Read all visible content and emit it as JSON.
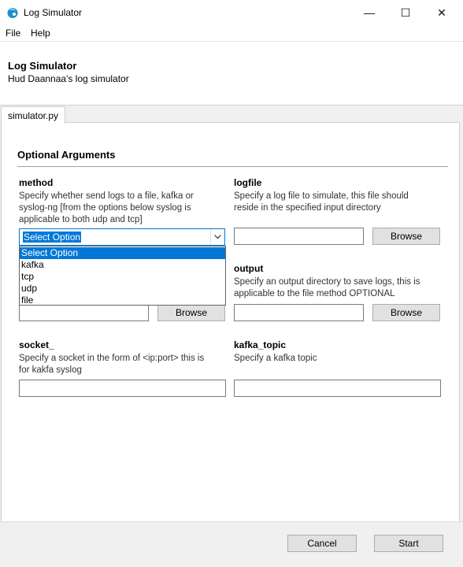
{
  "window": {
    "title": "Log Simulator",
    "minimize_glyph": "—",
    "maximize_glyph": "☐",
    "close_glyph": "✕"
  },
  "menu": {
    "items": [
      "File",
      "Help"
    ]
  },
  "header": {
    "title": "Log Simulator",
    "subtitle": "Hud Daannaa's log simulator"
  },
  "tab": {
    "label": "simulator.py"
  },
  "section": {
    "title": "Optional Arguments"
  },
  "fields": {
    "method": {
      "label": "method",
      "desc_lines": [
        "Specify whether send logs to a file, kafka or",
        "syslog-ng [from the options below syslog is",
        "applicable to both udp and tcp]"
      ],
      "selected": "Select Option",
      "options": [
        "Select Option",
        "kafka",
        "tcp",
        "udp",
        "file"
      ]
    },
    "logfile": {
      "label": "logfile",
      "desc_lines": [
        "Specify a log file to simulate, this file should",
        "reside in the specified input directory"
      ],
      "value": "",
      "browse": "Browse"
    },
    "input_dir": {
      "value": "",
      "browse": "Browse"
    },
    "output": {
      "label": "output",
      "desc_lines": [
        "Specify an output directory to save logs, this is",
        "applicable to the file method OPTIONAL"
      ],
      "value": "",
      "browse": "Browse"
    },
    "socket": {
      "label": "socket_",
      "desc_lines": [
        "Specify a socket in the form of <ip:port> this is",
        "for kakfa  syslog"
      ],
      "value": ""
    },
    "kafka_topic": {
      "label": "kafka_topic",
      "desc_lines": [
        "Specify a kafka topic"
      ],
      "value": ""
    }
  },
  "footer": {
    "cancel": "Cancel",
    "start": "Start"
  },
  "colors": {
    "accent": "#0078d7",
    "app_icon": "#1e90c8"
  }
}
